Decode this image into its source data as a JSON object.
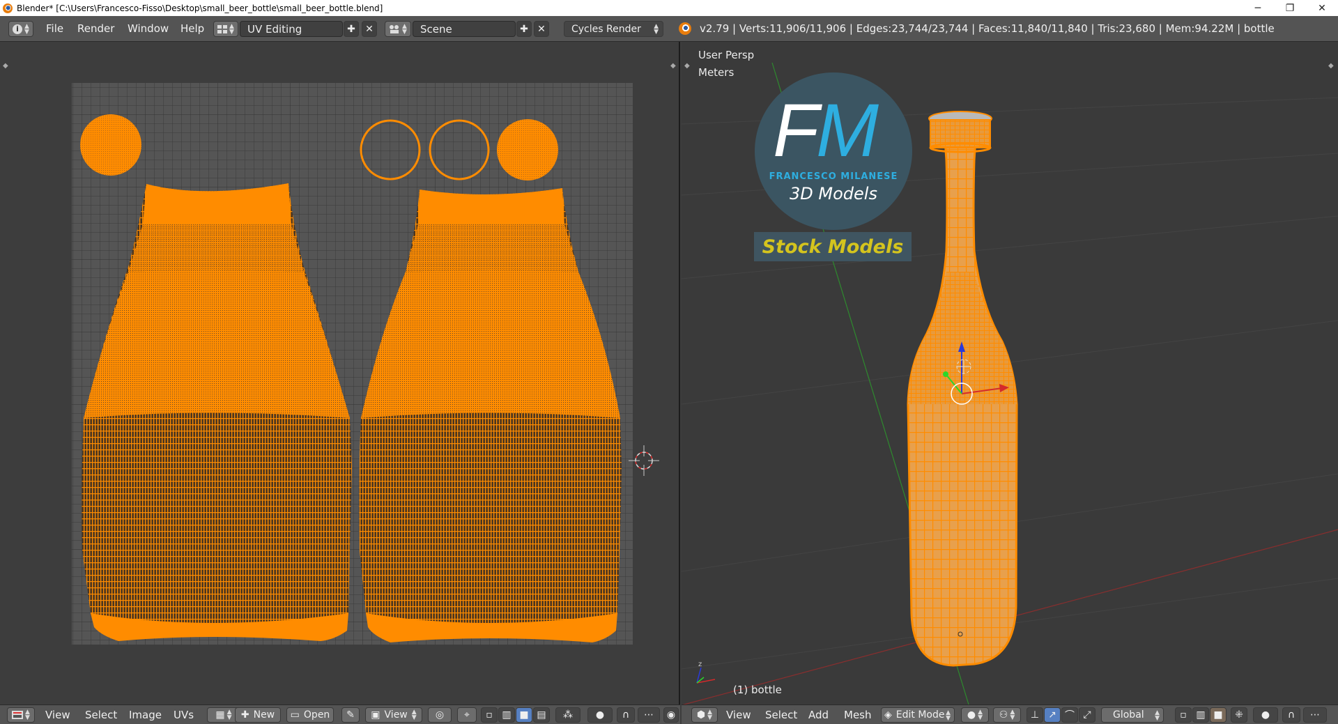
{
  "window": {
    "title": "Blender* [C:\\Users\\Francesco-Fisso\\Desktop\\small_beer_bottle\\small_beer_bottle.blend]",
    "minimize_glyph": "─",
    "maximize_glyph": "❐",
    "close_glyph": "✕"
  },
  "info_header": {
    "menus": [
      "File",
      "Render",
      "Window",
      "Help"
    ],
    "screen_layout": "UV Editing",
    "scene": "Scene",
    "render_engine": "Cycles Render",
    "stats": "v2.79 | Verts:11,906/11,906 | Edges:23,744/23,744 | Faces:11,840/11,840 | Tris:23,680 | Mem:94.22M | bottle"
  },
  "uv_header": {
    "menus": [
      "View",
      "Select",
      "Image",
      "UVs"
    ],
    "new_label": "New",
    "open_label": "Open",
    "view_label": "View"
  },
  "viewport": {
    "perspective_label": "User Persp",
    "units_label": "Meters",
    "object_label": "(1) bottle",
    "logo_name": "FRANCESCO MILANESE",
    "logo_subtitle": "3D Models",
    "stock_label": "Stock Models"
  },
  "viewport_header": {
    "menus": [
      "View",
      "Select",
      "Add",
      "Mesh"
    ],
    "mode": "Edit Mode",
    "orientation": "Global"
  },
  "colors": {
    "uv_wire": "#ff8c00",
    "background": "#3d3d3d",
    "header": "#545454"
  }
}
